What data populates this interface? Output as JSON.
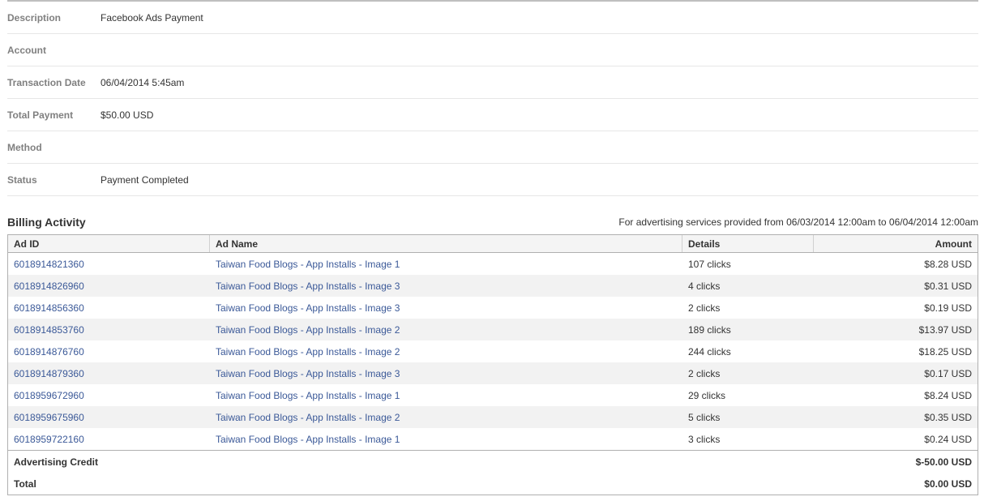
{
  "summary": {
    "description": {
      "label": "Description",
      "value": "Facebook Ads Payment"
    },
    "account": {
      "label": "Account",
      "value": ""
    },
    "transaction_date": {
      "label": "Transaction Date",
      "value": "06/04/2014 5:45am"
    },
    "total_payment": {
      "label": "Total Payment",
      "value": "$50.00 USD"
    },
    "method": {
      "label": "Method",
      "value": ""
    },
    "status": {
      "label": "Status",
      "value": "Payment Completed"
    }
  },
  "billing": {
    "title": "Billing Activity",
    "range_text": "For advertising services provided from 06/03/2014 12:00am to 06/04/2014 12:00am",
    "columns": {
      "ad_id": "Ad ID",
      "ad_name": "Ad Name",
      "details": "Details",
      "amount": "Amount"
    },
    "rows": [
      {
        "ad_id": "6018914821360",
        "ad_name": "Taiwan Food Blogs - App Installs - Image 1",
        "details": "107 clicks",
        "amount": "$8.28 USD"
      },
      {
        "ad_id": "6018914826960",
        "ad_name": "Taiwan Food Blogs - App Installs - Image 3",
        "details": "4 clicks",
        "amount": "$0.31 USD"
      },
      {
        "ad_id": "6018914856360",
        "ad_name": "Taiwan Food Blogs - App Installs - Image 3",
        "details": "2 clicks",
        "amount": "$0.19 USD"
      },
      {
        "ad_id": "6018914853760",
        "ad_name": "Taiwan Food Blogs - App Installs - Image 2",
        "details": "189 clicks",
        "amount": "$13.97 USD"
      },
      {
        "ad_id": "6018914876760",
        "ad_name": "Taiwan Food Blogs - App Installs - Image 2",
        "details": "244 clicks",
        "amount": "$18.25 USD"
      },
      {
        "ad_id": "6018914879360",
        "ad_name": "Taiwan Food Blogs - App Installs - Image 3",
        "details": "2 clicks",
        "amount": "$0.17 USD"
      },
      {
        "ad_id": "6018959672960",
        "ad_name": "Taiwan Food Blogs - App Installs - Image 1",
        "details": "29 clicks",
        "amount": "$8.24 USD"
      },
      {
        "ad_id": "6018959675960",
        "ad_name": "Taiwan Food Blogs - App Installs - Image 2",
        "details": "5 clicks",
        "amount": "$0.35 USD"
      },
      {
        "ad_id": "6018959722160",
        "ad_name": "Taiwan Food Blogs - App Installs - Image 1",
        "details": "3 clicks",
        "amount": "$0.24 USD"
      }
    ],
    "credit": {
      "label": "Advertising Credit",
      "amount": "$-50.00 USD"
    },
    "total": {
      "label": "Total",
      "amount": "$0.00 USD"
    }
  },
  "colors": {
    "link": "#3b5998",
    "label_gray": "#808080",
    "alt_row": "#f2f2f2"
  }
}
